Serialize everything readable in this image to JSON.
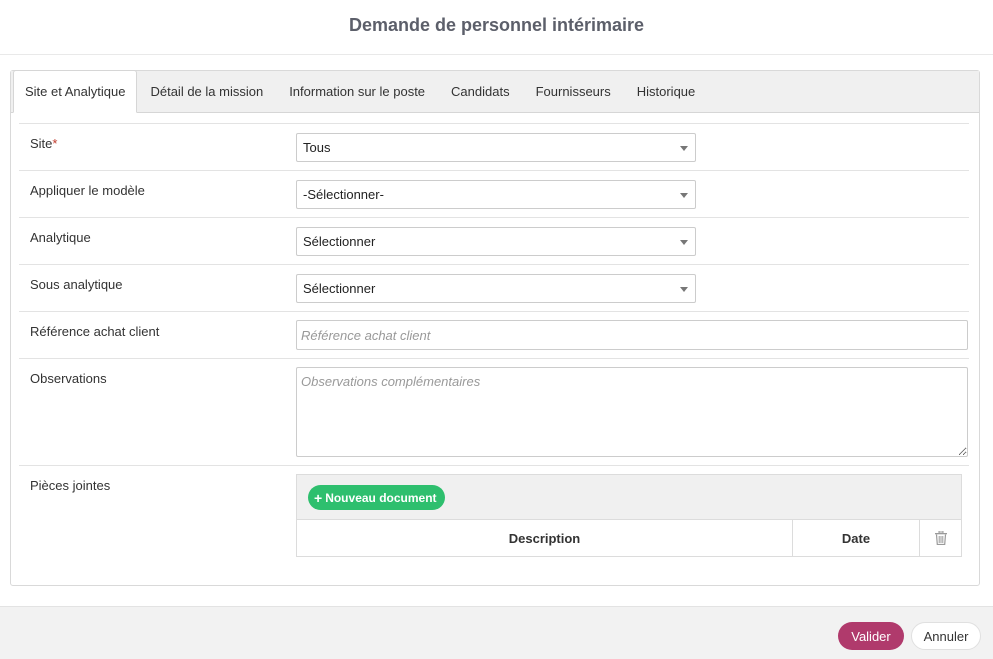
{
  "modal": {
    "title": "Demande de personnel intérimaire"
  },
  "tabs": [
    {
      "label": "Site et Analytique",
      "active": true
    },
    {
      "label": "Détail de la mission"
    },
    {
      "label": "Information sur le poste"
    },
    {
      "label": "Candidats"
    },
    {
      "label": "Fournisseurs"
    },
    {
      "label": "Historique"
    }
  ],
  "form": {
    "site": {
      "label": "Site",
      "required_mark": "*",
      "value": "Tous"
    },
    "model": {
      "label": "Appliquer le modèle",
      "value": "-Sélectionner-"
    },
    "analytic": {
      "label": "Analytique",
      "value": "Sélectionner"
    },
    "sub_analytic": {
      "label": "Sous analytique",
      "value": "Sélectionner"
    },
    "purchase_ref": {
      "label": "Référence achat client",
      "value": "",
      "placeholder": "Référence achat client"
    },
    "observations": {
      "label": "Observations",
      "value": "",
      "placeholder": "Observations complémentaires"
    },
    "attachments": {
      "label": "Pièces jointes",
      "new_button": "Nouveau document",
      "columns": {
        "description": "Description",
        "date": "Date"
      },
      "trash_icon": "trash-icon"
    }
  },
  "footer": {
    "validate": "Valider",
    "cancel": "Annuler"
  },
  "colors": {
    "accent_validate": "#b03a6c",
    "accent_new_doc": "#2ebf6e",
    "required": "#c0392b"
  }
}
